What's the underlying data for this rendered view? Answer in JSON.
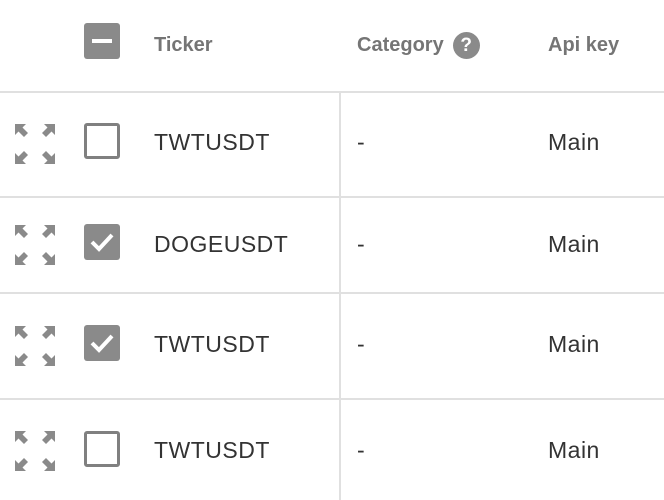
{
  "header": {
    "ticker_label": "Ticker",
    "category_label": "Category",
    "category_help_glyph": "?",
    "api_key_label": "Api key",
    "select_all_state": "indeterminate"
  },
  "rows": [
    {
      "ticker": "TWTUSDT",
      "category": "-",
      "api_key": "Main",
      "checked": false
    },
    {
      "ticker": "DOGEUSDT",
      "category": "-",
      "api_key": "Main",
      "checked": true
    },
    {
      "ticker": "TWTUSDT",
      "category": "-",
      "api_key": "Main",
      "checked": true
    },
    {
      "ticker": "TWTUSDT",
      "category": "-",
      "api_key": "Main",
      "checked": false
    }
  ],
  "icons": {
    "row_expand": "expand-arrows-icon",
    "help": "help-circle-icon",
    "check": "checkmark-icon"
  },
  "colors": {
    "icon_gray": "#8a8a8a",
    "header_text": "#757575",
    "body_text": "#333333",
    "divider": "#e0e0e0"
  }
}
